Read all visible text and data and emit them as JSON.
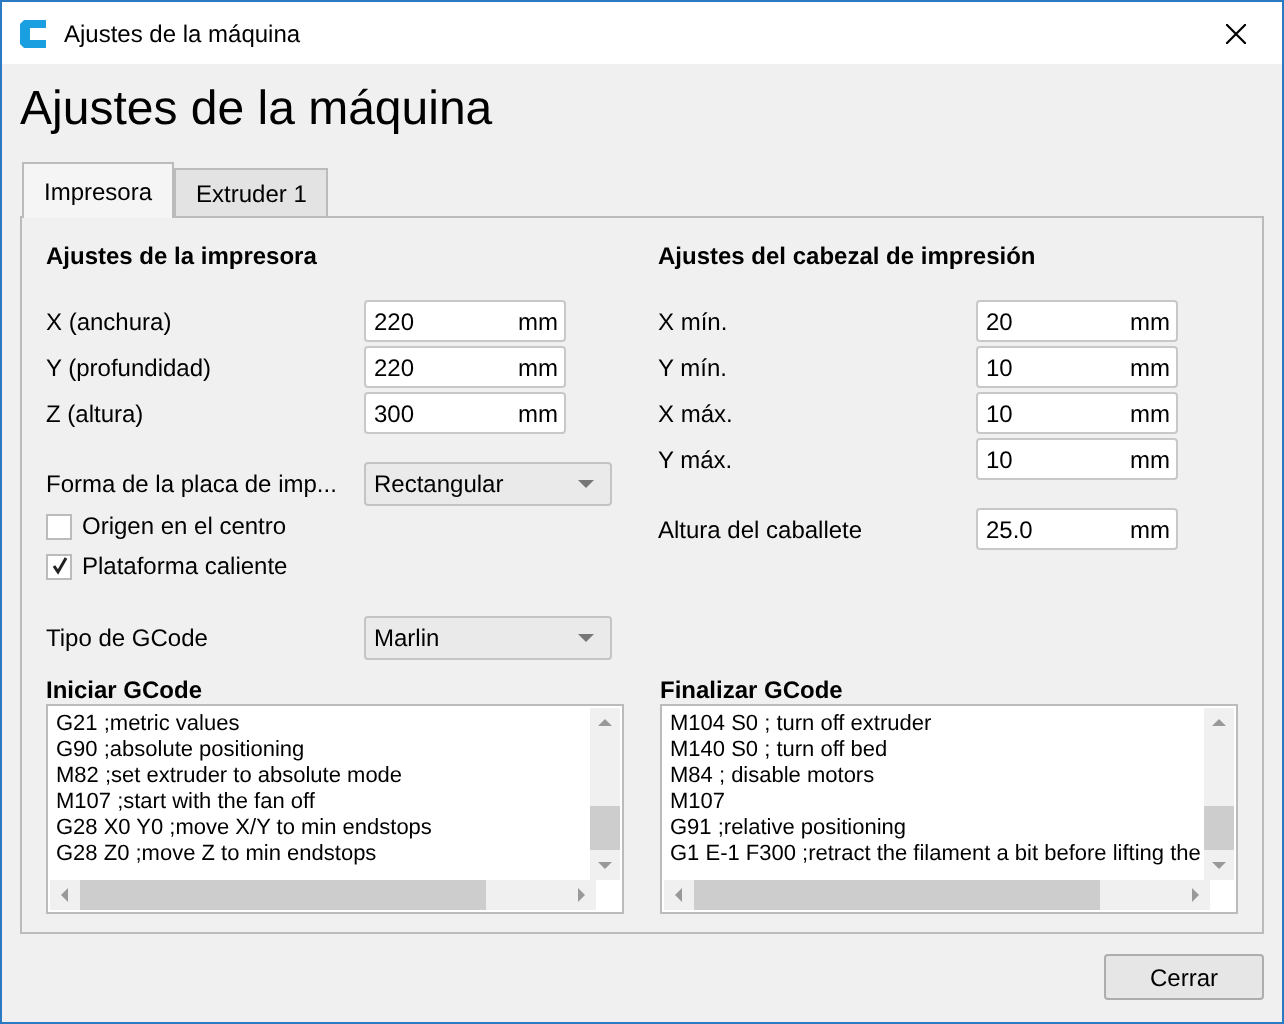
{
  "window": {
    "title": "Ajustes de la máquina"
  },
  "heading": "Ajustes de la máquina",
  "tabs": [
    {
      "label": "Impresora",
      "selected": true
    },
    {
      "label": "Extruder 1",
      "selected": false
    }
  ],
  "printer_settings": {
    "title": "Ajustes de la impresora",
    "fields": [
      {
        "label": "X (anchura)",
        "value": "220",
        "unit": "mm"
      },
      {
        "label": "Y (profundidad)",
        "value": "220",
        "unit": "mm"
      },
      {
        "label": "Z (altura)",
        "value": "300",
        "unit": "mm"
      }
    ],
    "build_plate_shape": {
      "label": "Forma de la placa de imp...",
      "value": "Rectangular"
    },
    "checkboxes": [
      {
        "label": "Origen en el centro",
        "checked": false
      },
      {
        "label": "Plataforma caliente",
        "checked": true
      }
    ],
    "gcode_flavor": {
      "label": "Tipo de GCode",
      "value": "Marlin"
    }
  },
  "printhead_settings": {
    "title": "Ajustes del cabezal de impresión",
    "fields": [
      {
        "label": "X mín.",
        "value": "20",
        "unit": "mm"
      },
      {
        "label": "Y mín.",
        "value": "10",
        "unit": "mm"
      },
      {
        "label": "X máx.",
        "value": "10",
        "unit": "mm"
      },
      {
        "label": "Y máx.",
        "value": "10",
        "unit": "mm"
      }
    ],
    "gantry_height": {
      "label": "Altura del caballete",
      "value": "25.0",
      "unit": "mm"
    }
  },
  "gcode": [
    {
      "title": "Iniciar GCode",
      "lines": [
        "G21 ;metric values",
        "G90 ;absolute positioning",
        "M82 ;set extruder to absolute mode",
        "M107 ;start with the fan off",
        "G28 X0 Y0 ;move X/Y to min endstops",
        "G28 Z0 ;move Z to min endstops"
      ]
    },
    {
      "title": "Finalizar GCode",
      "lines": [
        "M104 S0 ; turn off extruder",
        "M140 S0 ; turn off bed",
        "M84 ; disable motors",
        "M107",
        "G91 ;relative positioning",
        "G1 E-1 F300 ;retract the filament a bit before lifting the"
      ]
    }
  ],
  "close_button": "Cerrar"
}
